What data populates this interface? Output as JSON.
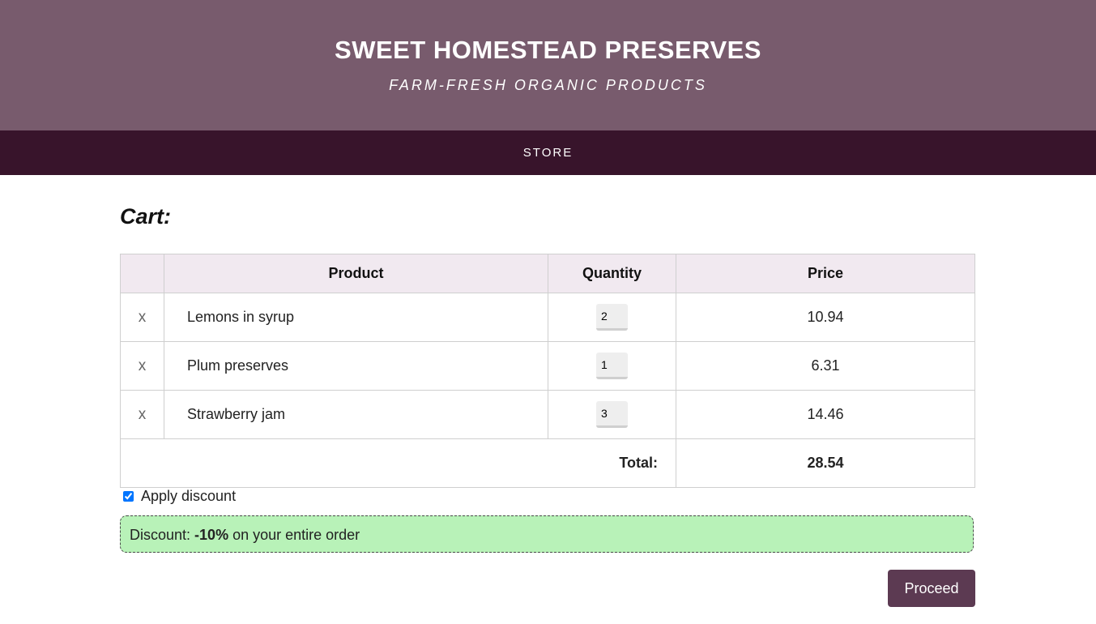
{
  "header": {
    "title": "SWEET HOMESTEAD PRESERVES",
    "tagline": "FARM-FRESH ORGANIC PRODUCTS"
  },
  "nav": {
    "items": [
      {
        "label": "STORE"
      }
    ]
  },
  "cart": {
    "heading": "Cart:",
    "columns": {
      "remove": "",
      "product": "Product",
      "quantity": "Quantity",
      "price": "Price"
    },
    "rows": [
      {
        "remove": "x",
        "product": "Lemons in syrup",
        "quantity": "2",
        "price": "10.94"
      },
      {
        "remove": "x",
        "product": "Plum preserves",
        "quantity": "1",
        "price": "6.31"
      },
      {
        "remove": "x",
        "product": "Strawberry jam",
        "quantity": "3",
        "price": "14.46"
      }
    ],
    "total_label": "Total:",
    "total_value": "28.54"
  },
  "discount": {
    "checkbox_label": "Apply discount",
    "checked": true,
    "prefix": "Discount: ",
    "amount": "-10%",
    "suffix": " on your entire order"
  },
  "actions": {
    "proceed_label": "Proceed"
  },
  "colors": {
    "header_bg": "#785b6d",
    "nav_bg": "#38142b",
    "table_header_bg": "#f1e9f0",
    "discount_bg": "#b8f2b8",
    "button_bg": "#5c3a52"
  }
}
